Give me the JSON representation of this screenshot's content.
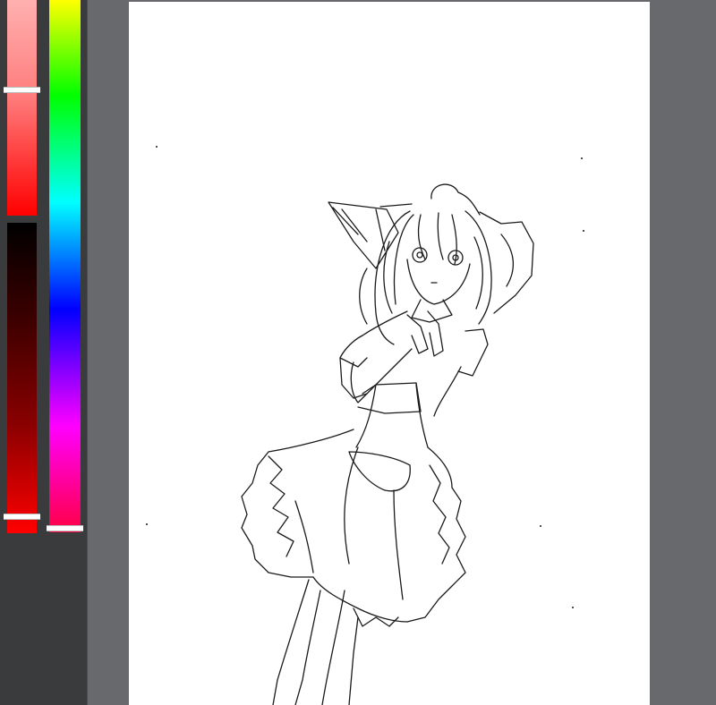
{
  "color_picker": {
    "lightness": 0.42,
    "saturation": 0.95,
    "hue": 0.99,
    "selected_color": "#ff0000"
  },
  "canvas": {
    "background": "#ffffff",
    "ink_color": "#1a1a1a",
    "content": "line-art-figure"
  },
  "workspace": {
    "background": "#67696d",
    "panel_background": "#3a3b3d"
  }
}
